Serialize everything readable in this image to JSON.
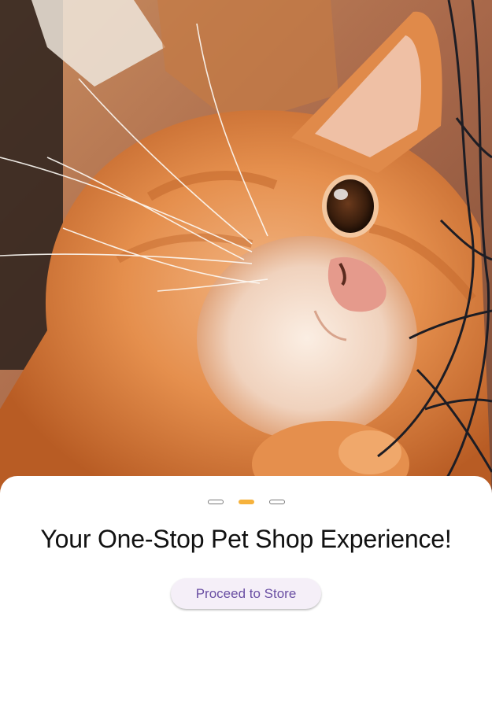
{
  "hero": {
    "image_subject": "orange tabby cat"
  },
  "pager": {
    "count": 3,
    "active_index": 1,
    "active_color": "#f6b23c",
    "inactive_color": "#7a7a7a"
  },
  "onboarding": {
    "headline": "Your One-Stop Pet Shop Experience!",
    "cta_label": "Proceed to Store",
    "cta_text_color": "#6a4fa3",
    "cta_bg_color": "#f5eff8"
  }
}
